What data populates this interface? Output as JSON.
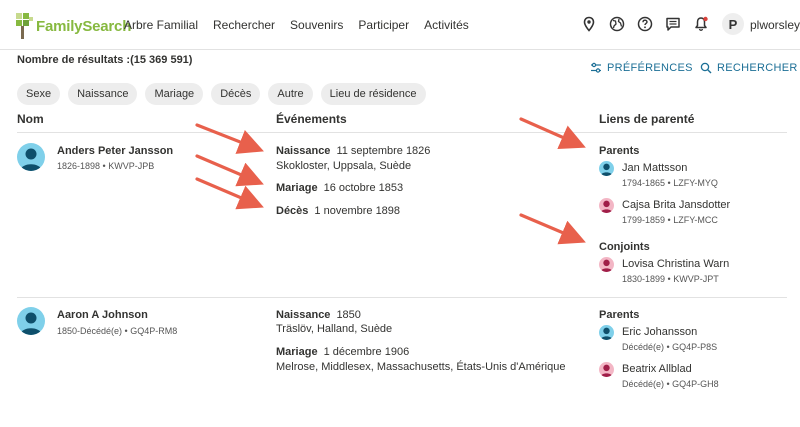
{
  "header": {
    "logo_text": "FamilySearch",
    "nav": [
      "Arbre Familial",
      "Rechercher",
      "Souvenirs",
      "Participer",
      "Activités"
    ],
    "avatar_letter": "P",
    "username": "plworsley"
  },
  "results": {
    "count_label": "Nombre de résultats :(15 369 591)",
    "preferences_label": "PRÉFÉRENCES",
    "search_label": "RECHERCHER"
  },
  "filters": [
    "Sexe",
    "Naissance",
    "Mariage",
    "Décès",
    "Autre",
    "Lieu de résidence"
  ],
  "columns": {
    "name": "Nom",
    "events": "Événements",
    "relations": "Liens de parenté"
  },
  "rows": [
    {
      "name": "Anders Peter Jansson",
      "meta": "1826-1898 •   KWVP-JPB",
      "events": [
        {
          "type": "Naissance",
          "date": "11 septembre 1826",
          "place": "Skokloster, Uppsala, Suède"
        },
        {
          "type": "Mariage",
          "date": "16 octobre 1853",
          "place": ""
        },
        {
          "type": "Décès",
          "date": "1 novembre 1898",
          "place": ""
        }
      ],
      "parents_title": "Parents",
      "parents": [
        {
          "name": "Jan Mattsson",
          "meta": "1794-1865 •   LZFY-MYQ",
          "gender": "m"
        },
        {
          "name": "Cajsa Brita Jansdotter",
          "meta": "1799-1859 •   LZFY-MCC",
          "gender": "f"
        }
      ],
      "spouses_title": "Conjoints",
      "spouses": [
        {
          "name": "Lovisa Christina Warn",
          "meta": "1830-1899 •   KWVP-JPT",
          "gender": "f"
        }
      ]
    },
    {
      "name": "Aaron A Johnson",
      "meta": "1850-Décédé(e) •   GQ4P-RM8",
      "events": [
        {
          "type": "Naissance",
          "date": "1850",
          "place": "Träslöv, Halland, Suède"
        },
        {
          "type": "Mariage",
          "date": "1 décembre 1906",
          "place": "Melrose, Middlesex, Massachusetts, États-Unis d'Amérique"
        }
      ],
      "parents_title": "Parents",
      "parents": [
        {
          "name": "Eric Johansson",
          "meta": "Décédé(e) •   GQ4P-P8S",
          "gender": "m"
        },
        {
          "name": "Beatrix Allblad",
          "meta": "Décédé(e) •   GQ4P-GH8",
          "gender": "f"
        }
      ]
    }
  ],
  "colors": {
    "brand_green": "#87b940",
    "link_blue": "#1c6f96",
    "annotation_arrow": "#e8604c",
    "male_avatar": "#7fd0ea",
    "female_avatar": "#f3b6c5"
  }
}
